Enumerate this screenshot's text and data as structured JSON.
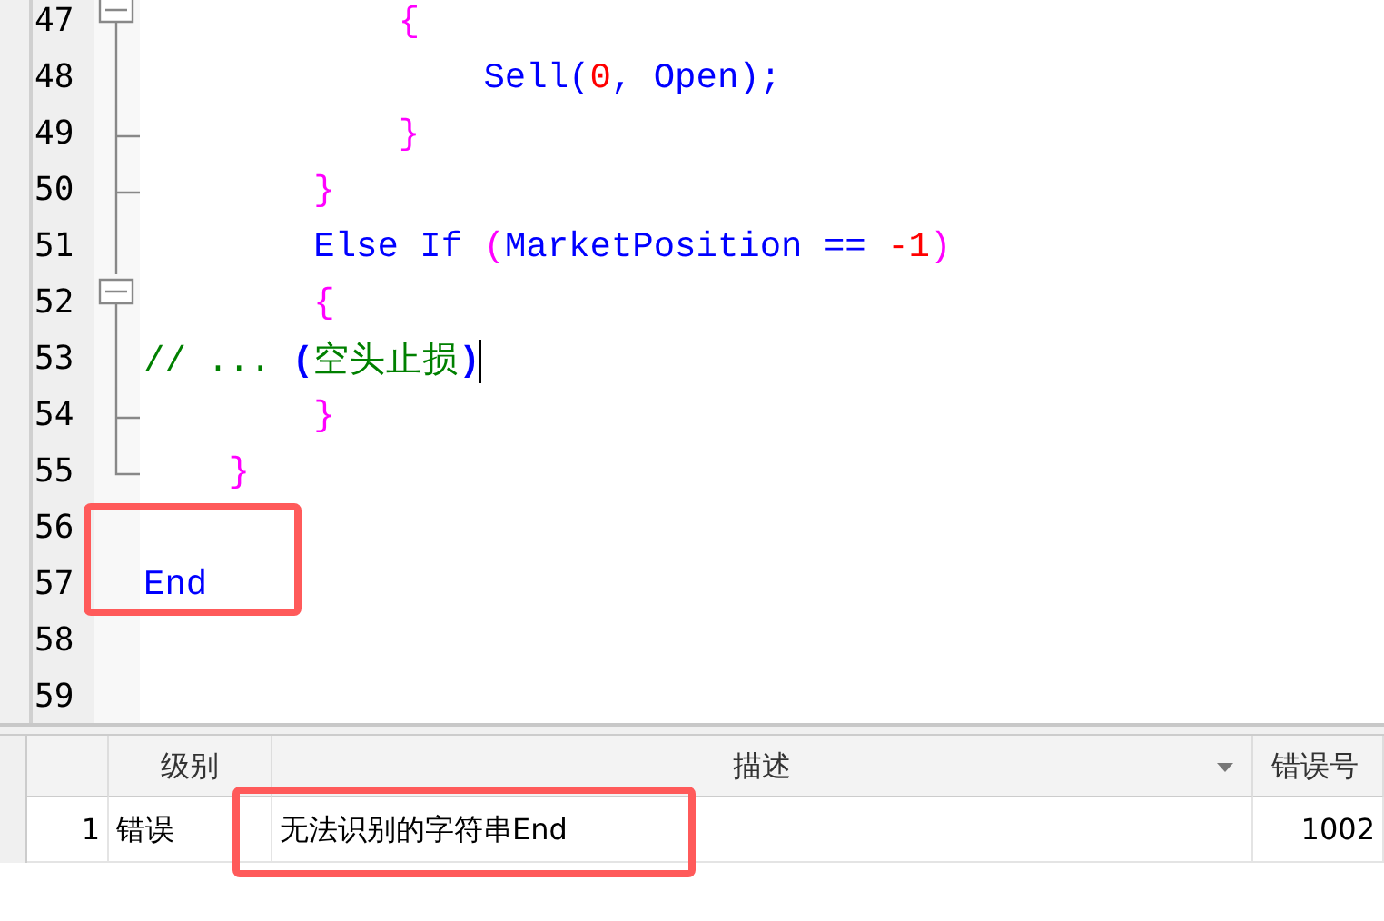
{
  "editor": {
    "lines": [
      {
        "number": "47",
        "kind": "fold-start",
        "tokens": [
          {
            "kind": "brace",
            "text": "            {"
          }
        ]
      },
      {
        "number": "48",
        "kind": "fold-line",
        "tokens": [
          {
            "kind": "keyword",
            "text": "                Sell("
          },
          {
            "kind": "number",
            "text": "0"
          },
          {
            "kind": "keyword",
            "text": ", Open);"
          }
        ]
      },
      {
        "number": "49",
        "kind": "fold-tick",
        "tokens": [
          {
            "kind": "brace",
            "text": "            }"
          }
        ]
      },
      {
        "number": "50",
        "kind": "fold-tick",
        "tokens": [
          {
            "kind": "brace",
            "text": "        }"
          }
        ]
      },
      {
        "number": "51",
        "kind": "fold-line",
        "tokens": [
          {
            "kind": "keyword",
            "text": "        Else If "
          },
          {
            "kind": "brace",
            "text": "("
          },
          {
            "kind": "keyword",
            "text": "MarketPosition == "
          },
          {
            "kind": "number",
            "text": "-1"
          },
          {
            "kind": "brace",
            "text": ")"
          }
        ]
      },
      {
        "number": "52",
        "kind": "fold-start",
        "tokens": [
          {
            "kind": "brace",
            "text": "        {"
          }
        ]
      },
      {
        "number": "53",
        "kind": "fold-line",
        "cursor": true,
        "tokens": [
          {
            "kind": "comment",
            "text": "// ... "
          },
          {
            "kind": "paren",
            "text": "("
          },
          {
            "kind": "comment",
            "text": "空头止损"
          },
          {
            "kind": "paren",
            "text": ")"
          }
        ]
      },
      {
        "number": "54",
        "kind": "fold-tick",
        "tokens": [
          {
            "kind": "brace",
            "text": "        }"
          }
        ]
      },
      {
        "number": "55",
        "kind": "fold-end",
        "tokens": [
          {
            "kind": "brace",
            "text": "    }"
          }
        ]
      },
      {
        "number": "56",
        "kind": "plain"
      },
      {
        "number": "57",
        "kind": "plain",
        "highlighted": true,
        "tokens": [
          {
            "kind": "keyword",
            "text": "End"
          }
        ]
      },
      {
        "number": "58",
        "kind": "plain"
      },
      {
        "number": "59",
        "kind": "plain"
      }
    ]
  },
  "errors": {
    "columns": [
      "级别",
      "描述",
      "错误号"
    ],
    "rows": [
      {
        "index": "1",
        "level": "错误",
        "description": "无法识别的字符串End",
        "code": "1002",
        "highlighted": true
      }
    ]
  }
}
